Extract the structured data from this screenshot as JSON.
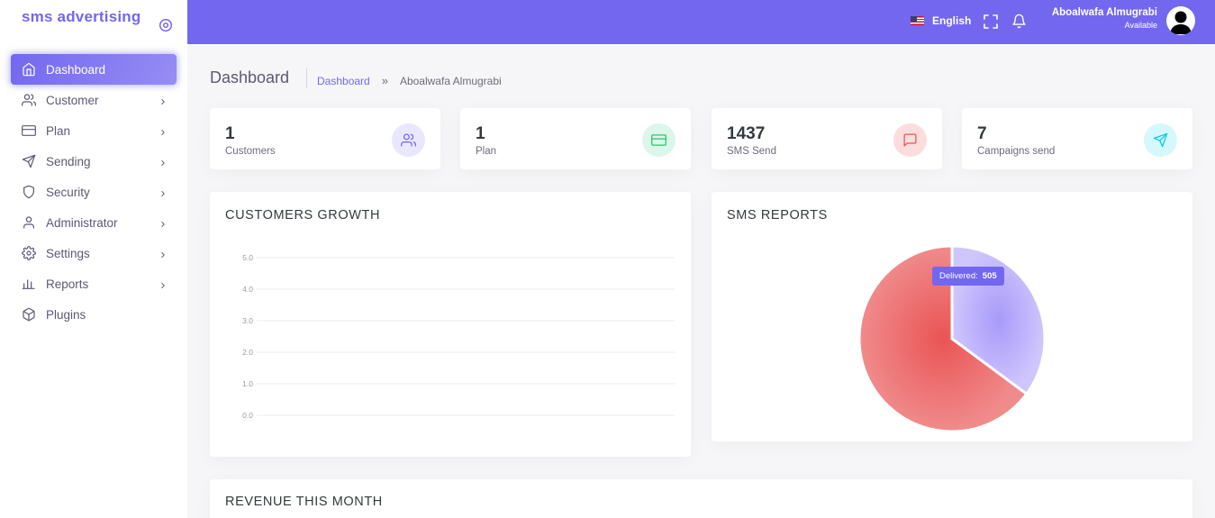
{
  "app": {
    "brand": "sms advertising"
  },
  "sidebar": {
    "items": [
      {
        "label": "Dashboard",
        "icon": "home-icon",
        "active": true,
        "has_children": false
      },
      {
        "label": "Customer",
        "icon": "users-icon",
        "has_children": true
      },
      {
        "label": "Plan",
        "icon": "credit-card-icon",
        "has_children": true
      },
      {
        "label": "Sending",
        "icon": "send-icon",
        "has_children": true
      },
      {
        "label": "Security",
        "icon": "shield-icon",
        "has_children": true
      },
      {
        "label": "Administrator",
        "icon": "user-icon",
        "has_children": true
      },
      {
        "label": "Settings",
        "icon": "settings-icon",
        "has_children": true
      },
      {
        "label": "Reports",
        "icon": "bar-chart-icon",
        "has_children": true
      },
      {
        "label": "Plugins",
        "icon": "package-icon",
        "has_children": false
      }
    ]
  },
  "topbar": {
    "language": "English",
    "user": {
      "name": "Aboalwafa Almugrabi",
      "status": "Available"
    }
  },
  "page": {
    "title": "Dashboard",
    "breadcrumb": {
      "link": "Dashboard",
      "separator": "»",
      "current": "Aboalwafa Almugrabi"
    }
  },
  "stats": [
    {
      "value": "1",
      "label": "Customers",
      "icon": "users-icon",
      "color": "#7367f0",
      "bg": "#e9e7fd"
    },
    {
      "value": "1",
      "label": "Plan",
      "icon": "credit-card-icon",
      "color": "#28c76f",
      "bg": "#dcf6e9"
    },
    {
      "value": "1437",
      "label": "SMS Send",
      "icon": "message-square-icon",
      "color": "#ea5455",
      "bg": "#fbdddd"
    },
    {
      "value": "7",
      "label": "Campaigns send",
      "icon": "send-icon",
      "color": "#00cfe8",
      "bg": "#d6f7fb"
    }
  ],
  "growth": {
    "title": "CUSTOMERS GROWTH",
    "chart_data": {
      "type": "line",
      "series": [],
      "y_ticks": [
        "5.0",
        "4.0",
        "3.0",
        "2.0",
        "1.0",
        "0.0"
      ],
      "ylim": [
        0,
        5
      ],
      "grid": true
    }
  },
  "sms_reports": {
    "title": "SMS REPORTS",
    "tooltip": {
      "label": "Delivered:",
      "value": "505"
    },
    "chart_data": {
      "type": "pie",
      "slices": [
        {
          "label": "Delivered",
          "value": 505,
          "color": "#c1b4fb"
        },
        {
          "label": "",
          "value": 932,
          "color": "#ea5455"
        }
      ]
    }
  },
  "revenue": {
    "title": "REVENUE THIS MONTH"
  },
  "colors": {
    "primary": "#7367f0",
    "danger": "#ea5455",
    "success": "#28c76f",
    "info": "#00cfe8"
  }
}
